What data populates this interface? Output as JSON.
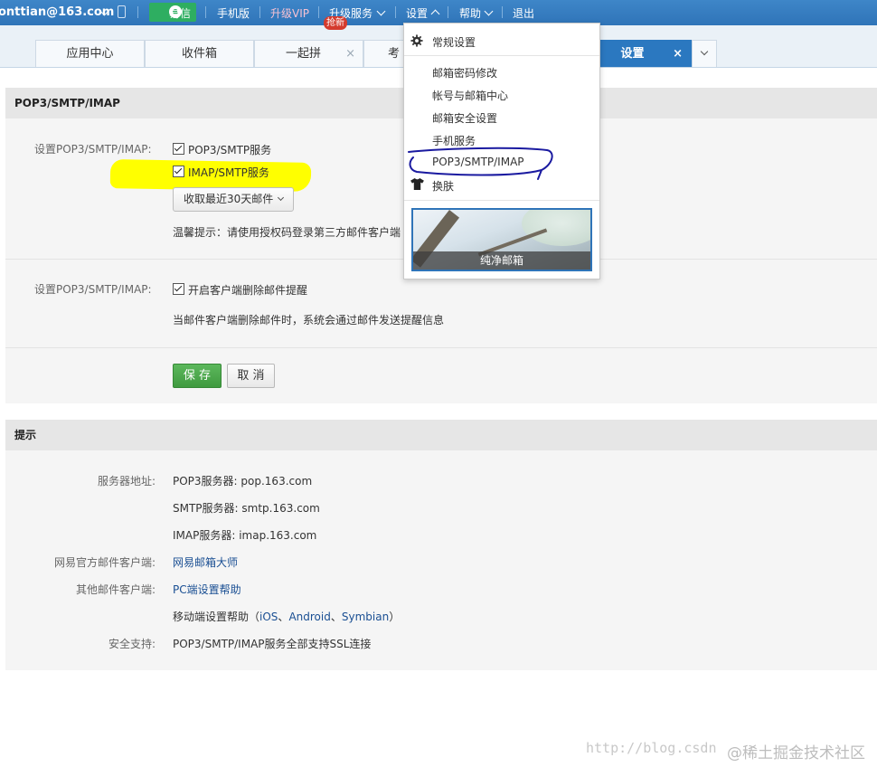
{
  "topbar": {
    "user": "onttian@163.com",
    "yixin": "易信",
    "mobile": "手机版",
    "vip": "升级VIP",
    "upgrade": "升级服务",
    "settings": "设置",
    "help": "帮助",
    "logout": "退出"
  },
  "tabs": [
    {
      "label": "应用中心"
    },
    {
      "label": "收件箱"
    },
    {
      "label": "一起拼",
      "badge": "抢新"
    },
    {
      "label": "考"
    },
    {
      "label": "设置"
    }
  ],
  "pop_panel": {
    "title": "POP3/SMTP/IMAP",
    "label1": "设置POP3/SMTP/IMAP:",
    "option_pop3": "POP3/SMTP服务",
    "option_imap": "IMAP/SMTP服务",
    "fetch_select": "收取最近30天邮件",
    "hint": "温馨提示：请使用授权码登录第三方邮件客户端",
    "label2": "设置POP3/SMTP/IMAP:",
    "option_delete_notify": "开启客户端删除邮件提醒",
    "delete_desc": "当邮件客户端删除邮件时，系统会通过邮件发送提醒信息",
    "save": "保 存",
    "cancel": "取 消"
  },
  "tips_panel": {
    "title": "提示",
    "server_label": "服务器地址:",
    "pop3": "POP3服务器: pop.163.com",
    "smtp": "SMTP服务器: smtp.163.com",
    "imap": "IMAP服务器: imap.163.com",
    "official_label": "网易官方邮件客户端:",
    "official_link": "网易邮箱大师",
    "other_label": "其他邮件客户端:",
    "pc_link": "PC端设置帮助",
    "mobile_prefix": "移动端设置帮助（",
    "ios": "iOS",
    "android": "Android",
    "symbian": "Symbian",
    "mobile_suffix": "）",
    "sep": "、",
    "security_label": "安全支持:",
    "security_value": "POP3/SMTP/IMAP服务全部支持SSL连接"
  },
  "menu": {
    "general": "常规设置",
    "password": "邮箱密码修改",
    "account": "帐号与邮箱中心",
    "security": "邮箱安全设置",
    "phone": "手机服务",
    "pop": "POP3/SMTP/IMAP",
    "skin": "换肤",
    "skin_caption": "纯净邮箱"
  },
  "watermark": {
    "url": "http://blog.csdn",
    "community": "@稀土掘金技术社区"
  },
  "colors": {
    "topbar": "#3e86c8",
    "active_tab": "#2b78c0",
    "save_button": "#5cb85c",
    "highlight": "#ffff00",
    "annotation": "#1a1aa0"
  }
}
